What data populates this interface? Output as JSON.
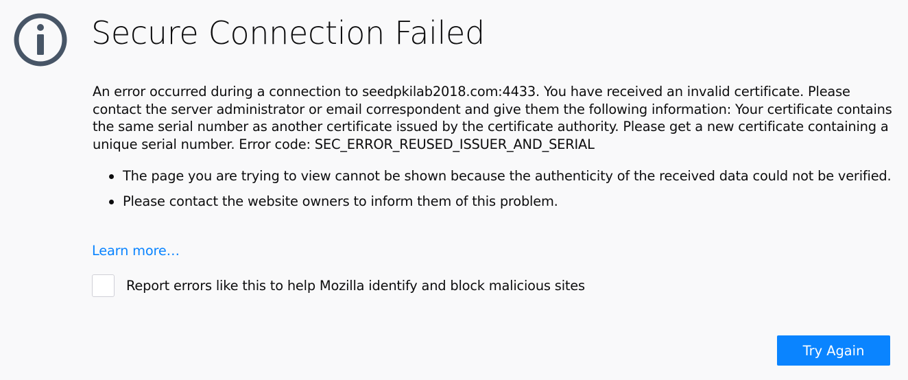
{
  "page": {
    "title": "Secure Connection Failed",
    "icon": "info-icon",
    "description": "An error occurred during a connection to seedpkilab2018.com:4433. You have received an invalid certificate. Please contact the server administrator or email correspondent and give them the following information: Your certificate contains the same serial number as another certificate issued by the certificate authority. Please get a new certificate containing a unique serial number. Error code: SEC_ERROR_REUSED_ISSUER_AND_SERIAL",
    "bullets": [
      "The page you are trying to view cannot be shown because the authenticity of the received data could not be verified.",
      "Please contact the website owners to inform them of this problem."
    ],
    "learn_more": "Learn more…",
    "report_label": "Report errors like this to help Mozilla identify and block malicious sites",
    "report_checked": false,
    "try_again": "Try Again"
  },
  "colors": {
    "background": "#f9f9fa",
    "accent": "#0a84ff",
    "icon": "#475566",
    "text": "#0c0c0d"
  }
}
